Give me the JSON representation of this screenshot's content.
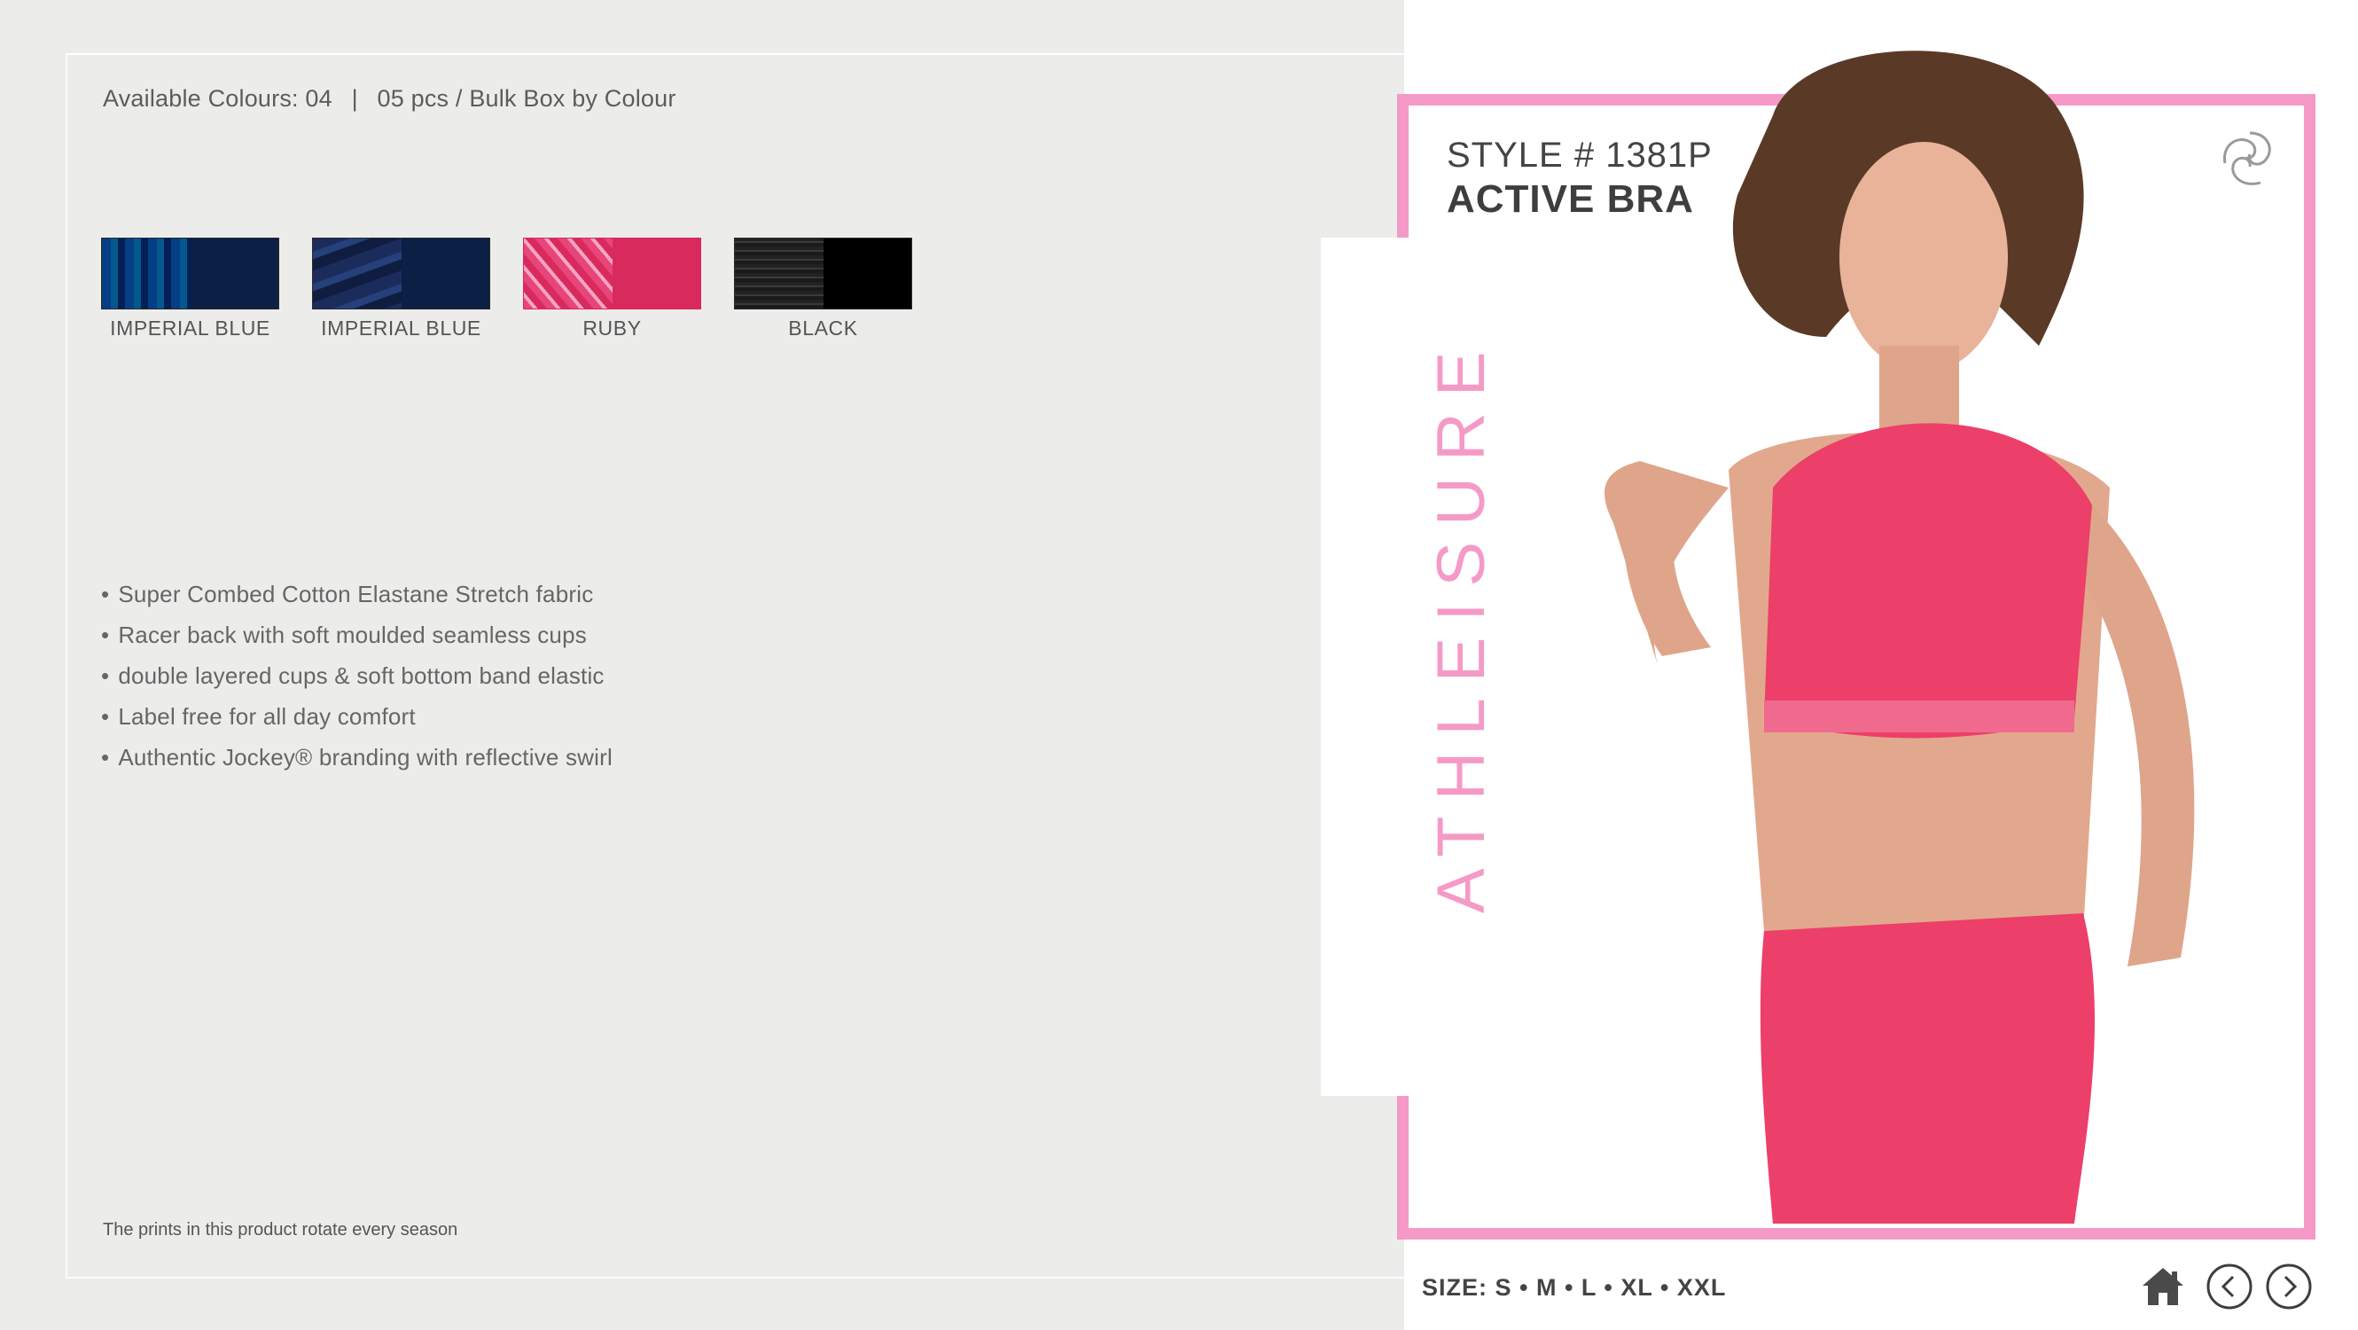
{
  "availability": {
    "colours": "Available Colours: 04",
    "separator": "|",
    "pack": "05 pcs / Bulk Box by Colour"
  },
  "swatches": [
    {
      "label": "IMPERIAL BLUE",
      "print_color": "#1e7fb8",
      "solid_color": "#0c1f44"
    },
    {
      "label": "IMPERIAL BLUE",
      "print_color": "#1b2c5c",
      "solid_color": "#0c1f44"
    },
    {
      "label": "RUBY",
      "print_color": "#e8457a",
      "solid_color": "#d92a5e"
    },
    {
      "label": "BLACK",
      "print_color": "#2d2d2d",
      "solid_color": "#000000"
    }
  ],
  "features": [
    "Super Combed Cotton Elastane Stretch fabric",
    "Racer back with soft moulded seamless cups",
    "double layered cups & soft bottom band elastic",
    "Label free for all day comfort",
    "Authentic Jockey® branding with reflective swirl"
  ],
  "footnote": "The prints in this product rotate every season",
  "product": {
    "style_number": "STYLE # 1381P",
    "style_name": "ACTIVE BRA",
    "category": "ATHLEISURE",
    "sizes": "SIZE: S • M • L • XL • XXL"
  },
  "colors": {
    "accent_pink": "#f59ac7",
    "product_red": "#ec3f69",
    "background": "#ececea"
  },
  "icons": {
    "brand": "swirl-logo-icon",
    "home": "home-icon",
    "prev": "chevron-left-icon",
    "next": "chevron-right-icon"
  }
}
